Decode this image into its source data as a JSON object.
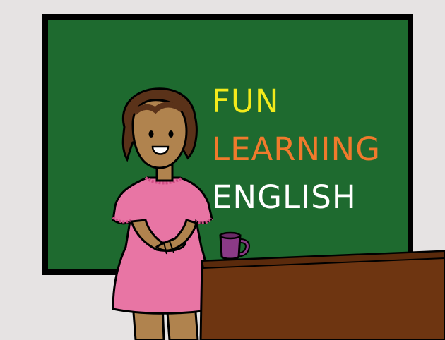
{
  "board_text": {
    "line1": "FUN",
    "line2": "LEARNING",
    "line3": "ENGLISH"
  },
  "colors": {
    "wall": "#e6e3e3",
    "board_frame": "#000000",
    "board_surface": "#1e6a2f",
    "line1": "#f2ea1b",
    "line2": "#f07a2c",
    "line3": "#ffffff",
    "desk": "#6e3511",
    "dress": "#e875a4",
    "skin": "#b0834e",
    "hair": "#5a3219",
    "mug": "#8b3a87"
  },
  "icons": [
    "teacher-figure-icon",
    "coffee-mug-icon",
    "desk-icon",
    "chalkboard-icon"
  ]
}
